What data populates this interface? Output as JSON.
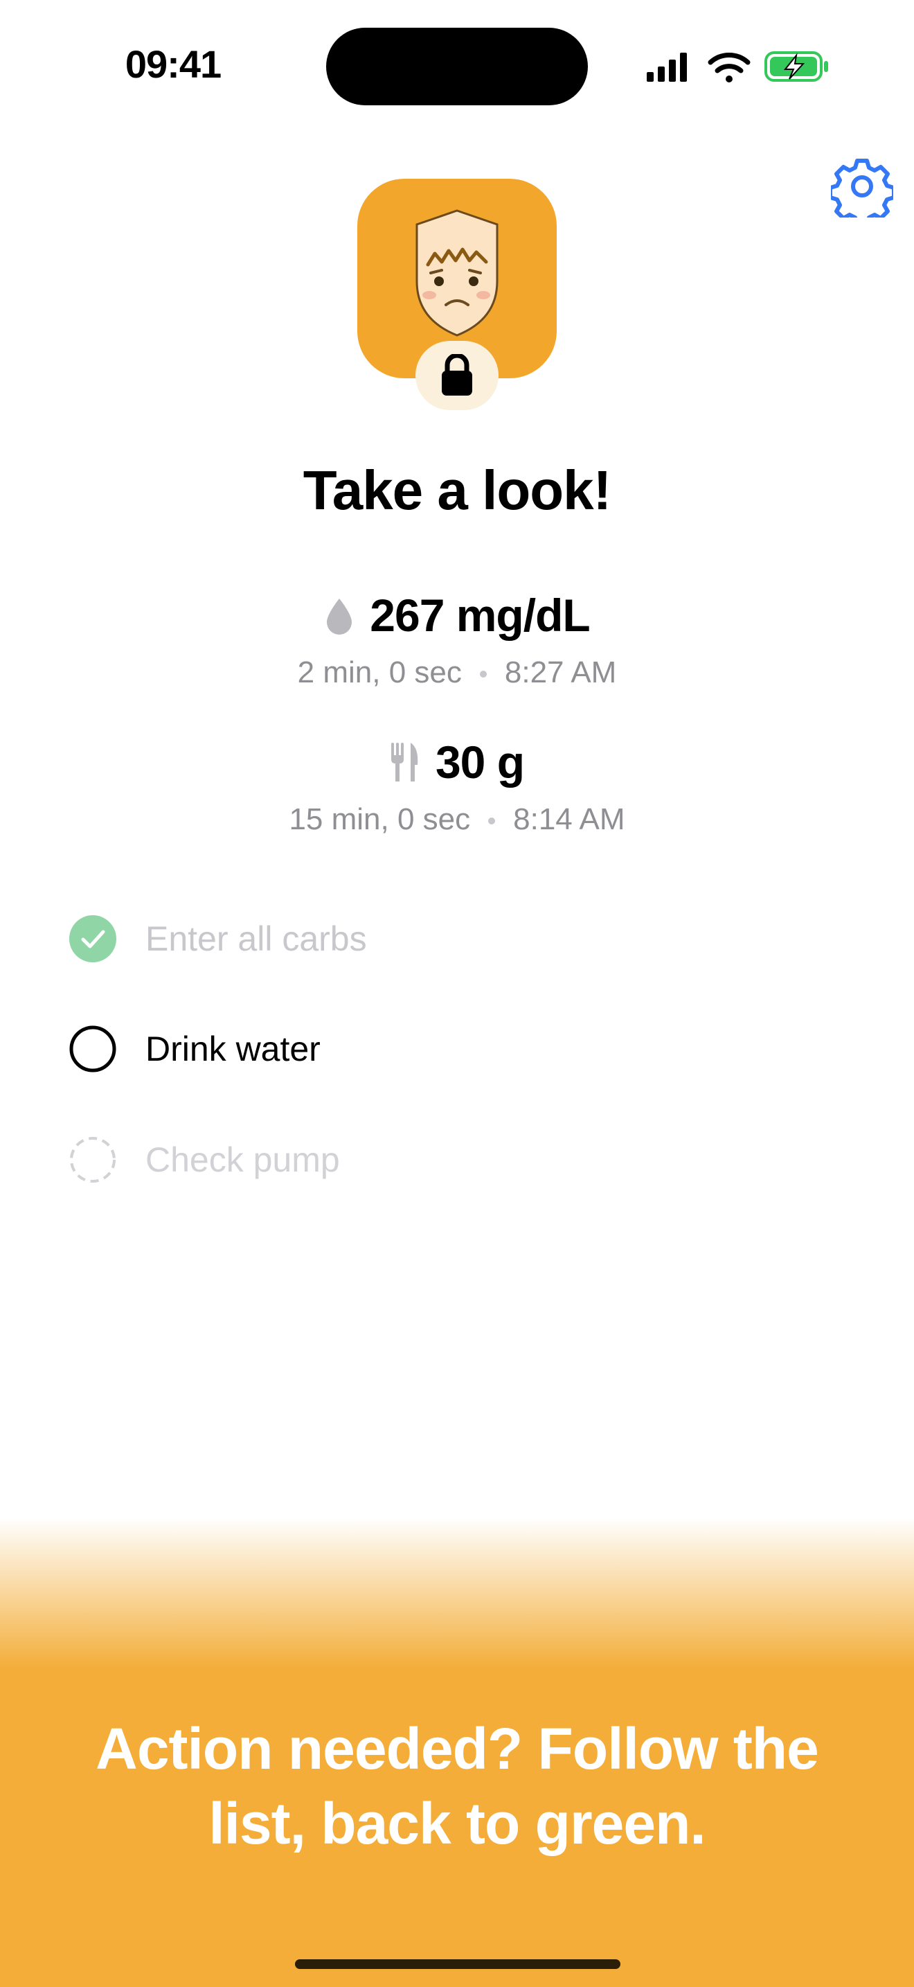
{
  "status_bar": {
    "time": "09:41"
  },
  "colors": {
    "accent_orange": "#f3ad38",
    "app_icon_orange": "#f2a72c",
    "settings_blue": "#3478f6",
    "check_green": "#8fd5a6",
    "battery_green": "#34c759"
  },
  "icons": {
    "settings": "gear-icon",
    "lock": "lock-icon",
    "glucose": "drop-icon",
    "carbs": "fork-knife-icon"
  },
  "header": {
    "title": "Take a look!"
  },
  "glucose": {
    "value": "267 mg/dL",
    "elapsed": "2 min, 0 sec",
    "time": "8:27 AM"
  },
  "carbs": {
    "value": "30 g",
    "elapsed": "15 min, 0 sec",
    "time": "8:14 AM"
  },
  "tasks": [
    {
      "label": "Enter all carbs",
      "state": "done"
    },
    {
      "label": "Drink water",
      "state": "pending"
    },
    {
      "label": "Check pump",
      "state": "disabled"
    }
  ],
  "promo": {
    "line1": "Action needed? Follow the",
    "line2": "list, back to green."
  }
}
